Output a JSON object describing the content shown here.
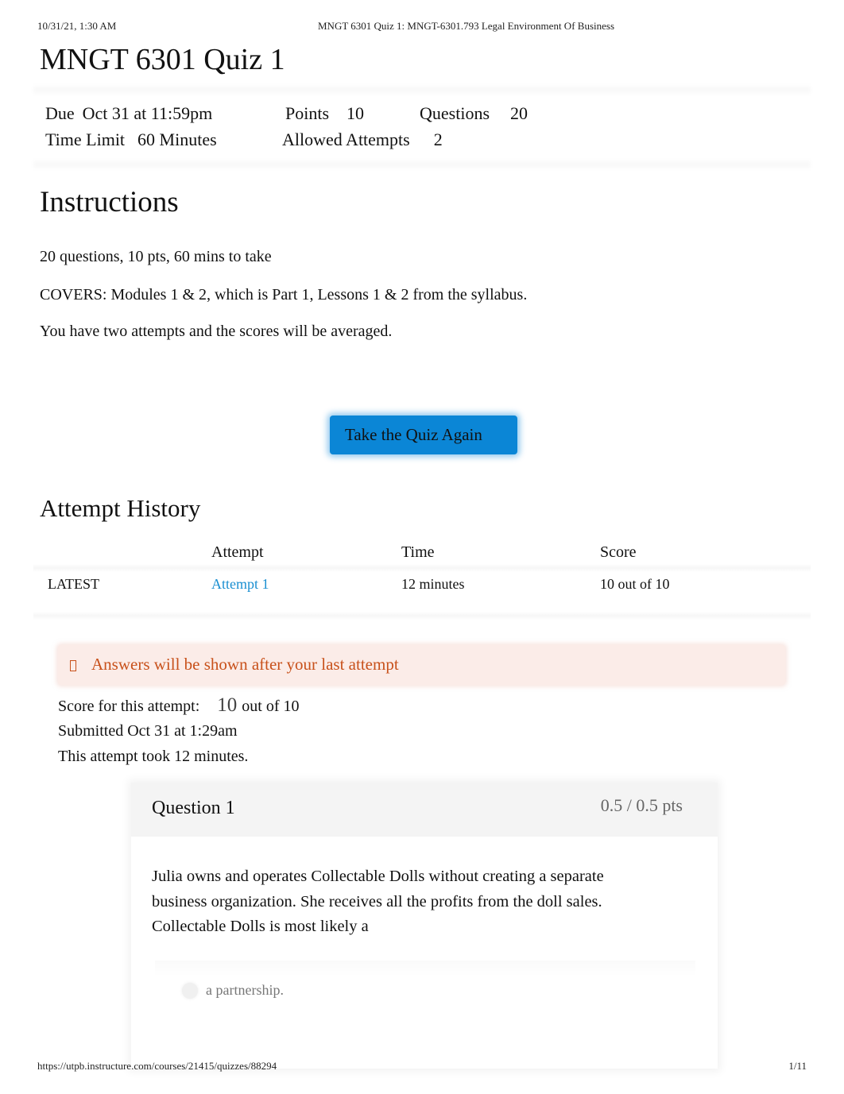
{
  "print_header": {
    "datetime": "10/31/21, 1:30 AM",
    "doc_title": "MNGT 6301 Quiz 1: MNGT-6301.793 Legal Environment Of Business"
  },
  "page_title": "MNGT 6301 Quiz 1",
  "details": {
    "due_label": "Due",
    "due_value": "Oct 31 at 11:59pm",
    "points_label": "Points",
    "points_value": "10",
    "questions_label": "Questions",
    "questions_value": "20",
    "time_limit_label": "Time Limit",
    "time_limit_value": "60 Minutes",
    "attempts_label": "Allowed Attempts",
    "attempts_value": "2"
  },
  "instructions": {
    "heading": "Instructions",
    "paragraphs": [
      "20 questions, 10 pts, 60 mins to take",
      "COVERS: Modules 1 & 2, which is Part 1, Lessons 1 & 2 from the syllabus.",
      "You have two attempts and the scores will be averaged."
    ]
  },
  "take_quiz_button": "Take the Quiz Again",
  "attempt_history": {
    "heading": "Attempt History",
    "columns": [
      "",
      "Attempt",
      "Time",
      "Score"
    ],
    "rows": [
      {
        "tag": "LATEST",
        "attempt": "Attempt 1",
        "time": "12 minutes",
        "score": "10 out of 10"
      }
    ]
  },
  "alert": {
    "icon": "warning-icon",
    "text": "Answers will be shown after your last attempt",
    "color": "#c8511b"
  },
  "summary": {
    "score_label": "Score for this attempt:",
    "score_value": "10",
    "score_suffix": "out of 10",
    "submitted": "Submitted Oct 31 at 1:29am",
    "duration": "This attempt took 12 minutes."
  },
  "question": {
    "title": "Question 1",
    "points": "0.5 / 0.5 pts",
    "text": "Julia owns and operates Collectable Dolls without creating a separate business organization. She receives all the profits from the doll sales. Collectable Dolls is most likely a",
    "answers": [
      "a partnership."
    ]
  },
  "print_footer": {
    "url": "https://utpb.instructure.com/courses/21415/quizzes/88294",
    "page": "1/11"
  },
  "colors": {
    "button_bg": "#0b86d6",
    "link": "#1a8fd1",
    "alert_bg": "#fbece8"
  }
}
